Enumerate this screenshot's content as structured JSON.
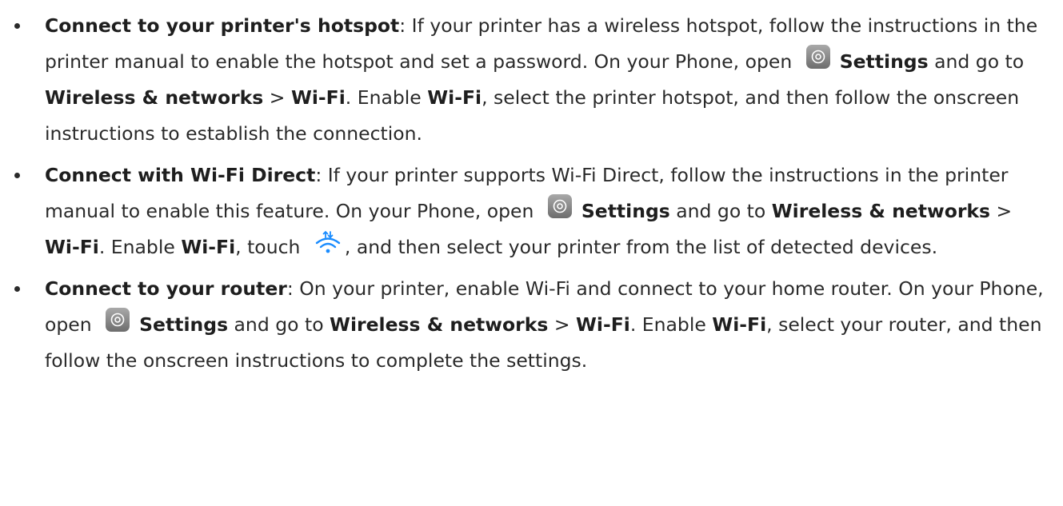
{
  "colors": {
    "text": "#2a2a2a",
    "icon_gray": "#8a8a8a",
    "wifi_blue": "#1a8cff"
  },
  "icons": {
    "settings": "settings-gear-icon",
    "wifi": "wifi-direct-icon"
  },
  "items": [
    {
      "title": "Connect to your printer's hotspot",
      "t1": ": If your printer has a wireless hotspot, follow the instructions in the printer manual to enable the hotspot and set a password. On your Phone, open ",
      "settings": "Settings",
      "t2": " and go to ",
      "wn": "Wireless & networks",
      "sep": " > ",
      "wifi": "Wi-Fi",
      "t3": ". Enable ",
      "wifi2": "Wi-Fi",
      "t4": ", select the printer hotspot, and then follow the onscreen instructions to establish the connection."
    },
    {
      "title": "Connect with Wi-Fi Direct",
      "t1": ": If your printer supports Wi-Fi Direct, follow the instructions in the printer manual to enable this feature. On your Phone, open ",
      "settings": "Settings",
      "t2": " and go to ",
      "wn": "Wireless & networks",
      "sep": " > ",
      "wifi": "Wi-Fi",
      "t3": ". Enable ",
      "wifi2": "Wi-Fi",
      "t4": ", touch ",
      "t5": ", and then select your printer from the list of detected devices."
    },
    {
      "title": "Connect to your router",
      "t1": ": On your printer, enable Wi-Fi and connect to your home router. On your Phone, open ",
      "settings": "Settings",
      "t2": " and go to ",
      "wn": "Wireless & networks",
      "sep": " > ",
      "wifi": "Wi-Fi",
      "t3": ". Enable ",
      "wifi2": "Wi-Fi",
      "t4": ", select your router, and then follow the onscreen instructions to complete the settings."
    }
  ]
}
